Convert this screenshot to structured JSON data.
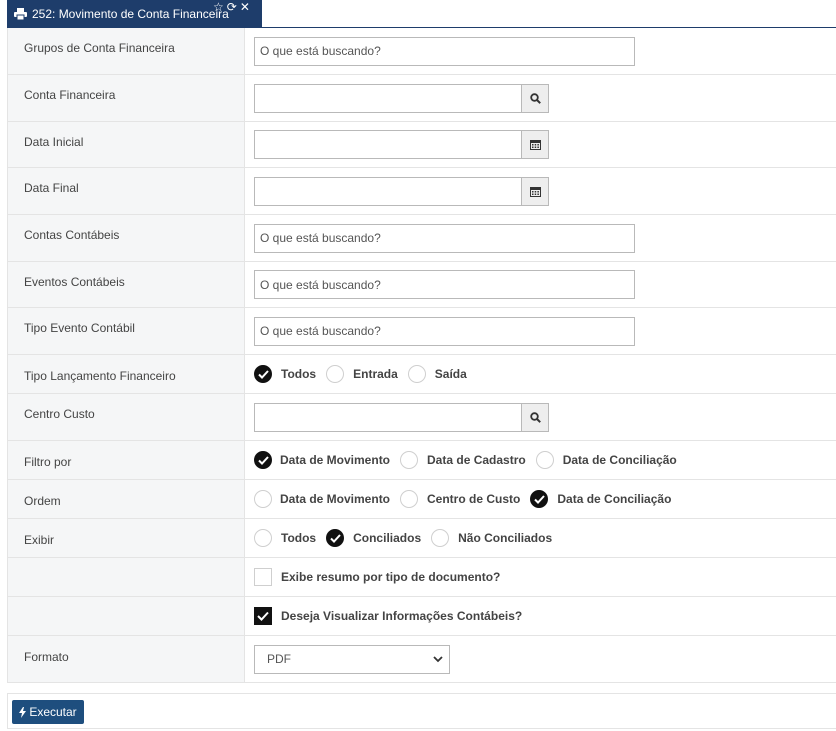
{
  "tab": {
    "title": "252: Movimento de Conta Financeira",
    "icons": [
      "printer-icon",
      "star-icon",
      "refresh-icon",
      "close-icon"
    ]
  },
  "fields": {
    "grupos_conta": {
      "label": "Grupos de Conta Financeira",
      "placeholder": "O que está buscando?"
    },
    "conta_financeira": {
      "label": "Conta Financeira",
      "value": ""
    },
    "data_inicial": {
      "label": "Data Inicial",
      "value": ""
    },
    "data_final": {
      "label": "Data Final",
      "value": ""
    },
    "contas_contabeis": {
      "label": "Contas Contábeis",
      "placeholder": "O que está buscando?"
    },
    "eventos_contabeis": {
      "label": "Eventos Contábeis",
      "placeholder": "O que está buscando?"
    },
    "tipo_evento": {
      "label": "Tipo Evento Contábil",
      "placeholder": "O que está buscando?"
    },
    "tipo_lancamento": {
      "label": "Tipo Lançamento Financeiro",
      "options": [
        "Todos",
        "Entrada",
        "Saída"
      ],
      "selected": "Todos"
    },
    "centro_custo": {
      "label": "Centro Custo",
      "value": ""
    },
    "filtro_por": {
      "label": "Filtro por",
      "options": [
        "Data de Movimento",
        "Data de Cadastro",
        "Data de Conciliação"
      ],
      "selected": "Data de Movimento"
    },
    "ordem": {
      "label": "Ordem",
      "options": [
        "Data de Movimento",
        "Centro de Custo",
        "Data de Conciliação"
      ],
      "selected": "Data de Conciliação"
    },
    "exibir": {
      "label": "Exibir",
      "options": [
        "Todos",
        "Conciliados",
        "Não Conciliados"
      ],
      "selected": "Conciliados"
    },
    "exibe_resumo": {
      "label": "Exibe resumo por tipo de documento?",
      "checked": false
    },
    "visualizar_contabeis": {
      "label": "Deseja Visualizar Informações Contábeis?",
      "checked": true
    },
    "formato": {
      "label": "Formato",
      "selected": "PDF"
    }
  },
  "footer": {
    "execute_label": "Executar"
  },
  "colors": {
    "primary": "#1e3d6b",
    "button": "#1e4e7e",
    "label_bg": "#f5f6f7",
    "checked": "#111111"
  }
}
